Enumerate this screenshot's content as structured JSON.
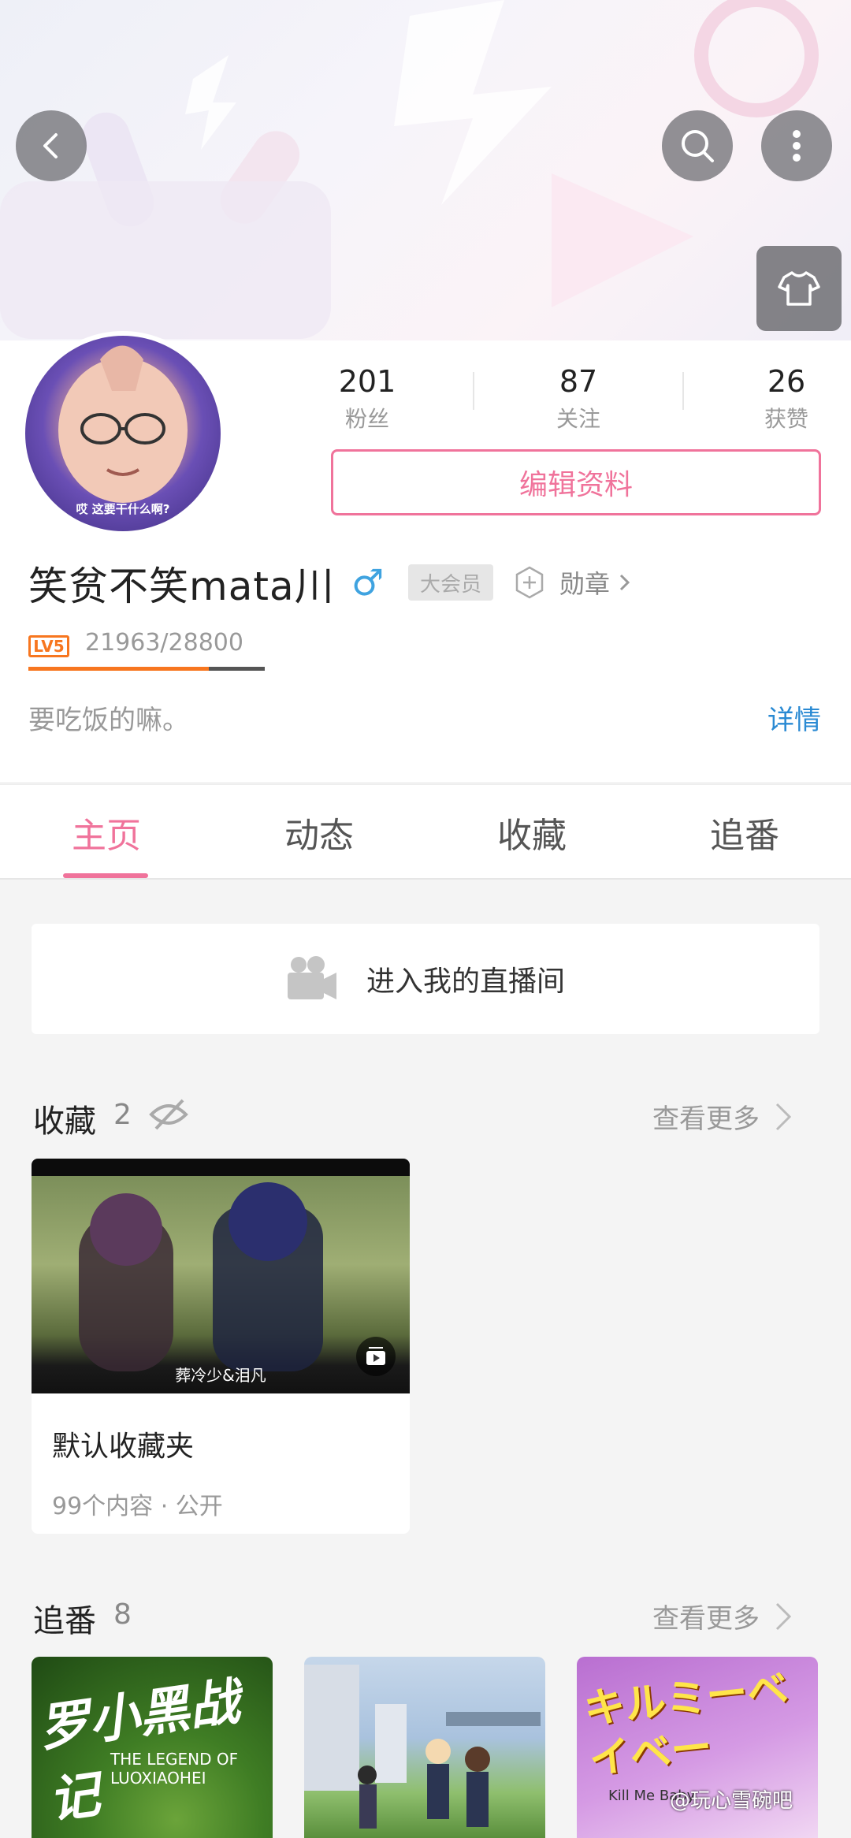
{
  "header": {
    "back_icon": "back-icon",
    "search_icon": "search-icon",
    "more_icon": "more-vertical-icon",
    "skin_icon": "tshirt-icon"
  },
  "profile": {
    "avatar_caption": "哎 这要干什么啊?",
    "stats": [
      {
        "num": "201",
        "label": "粉丝"
      },
      {
        "num": "87",
        "label": "关注"
      },
      {
        "num": "26",
        "label": "获赞"
      }
    ],
    "edit_label": "编辑资料",
    "username": "笑贫不笑mata川",
    "gender_symbol": "♂",
    "vip_tag": "大会员",
    "medal_label": "勋章",
    "level_badge": "LV5",
    "level_progress": "21963/28800",
    "level_fraction": 0.763,
    "signature": "要吃饭的嘛。",
    "detail_link": "详情"
  },
  "tabs": [
    {
      "label": "主页",
      "active": true
    },
    {
      "label": "动态",
      "active": false
    },
    {
      "label": "收藏",
      "active": false
    },
    {
      "label": "追番",
      "active": false
    }
  ],
  "live": {
    "label": "进入我的直播间"
  },
  "favorites": {
    "title": "收藏",
    "count": "2",
    "more": "查看更多",
    "card": {
      "thumb_caption": "葬冷少&泪凡",
      "name": "默认收藏夹",
      "meta": "99个内容 · 公开"
    }
  },
  "bangumi": {
    "title": "追番",
    "count": "8",
    "more": "查看更多",
    "items": [
      {
        "title": "罗小黑战记",
        "subtitle": "THE LEGEND OF LUOXIAOHEI"
      },
      {
        "title": "",
        "subtitle": ""
      },
      {
        "title": "キルミーベイベー",
        "subtitle": "Kill Me Baby"
      }
    ]
  },
  "watermark": "@玩心雪碗吧",
  "colors": {
    "accent": "#f0739b",
    "link": "#2a8ad3",
    "level": "#f7761f",
    "gender": "#3fa3e0"
  }
}
